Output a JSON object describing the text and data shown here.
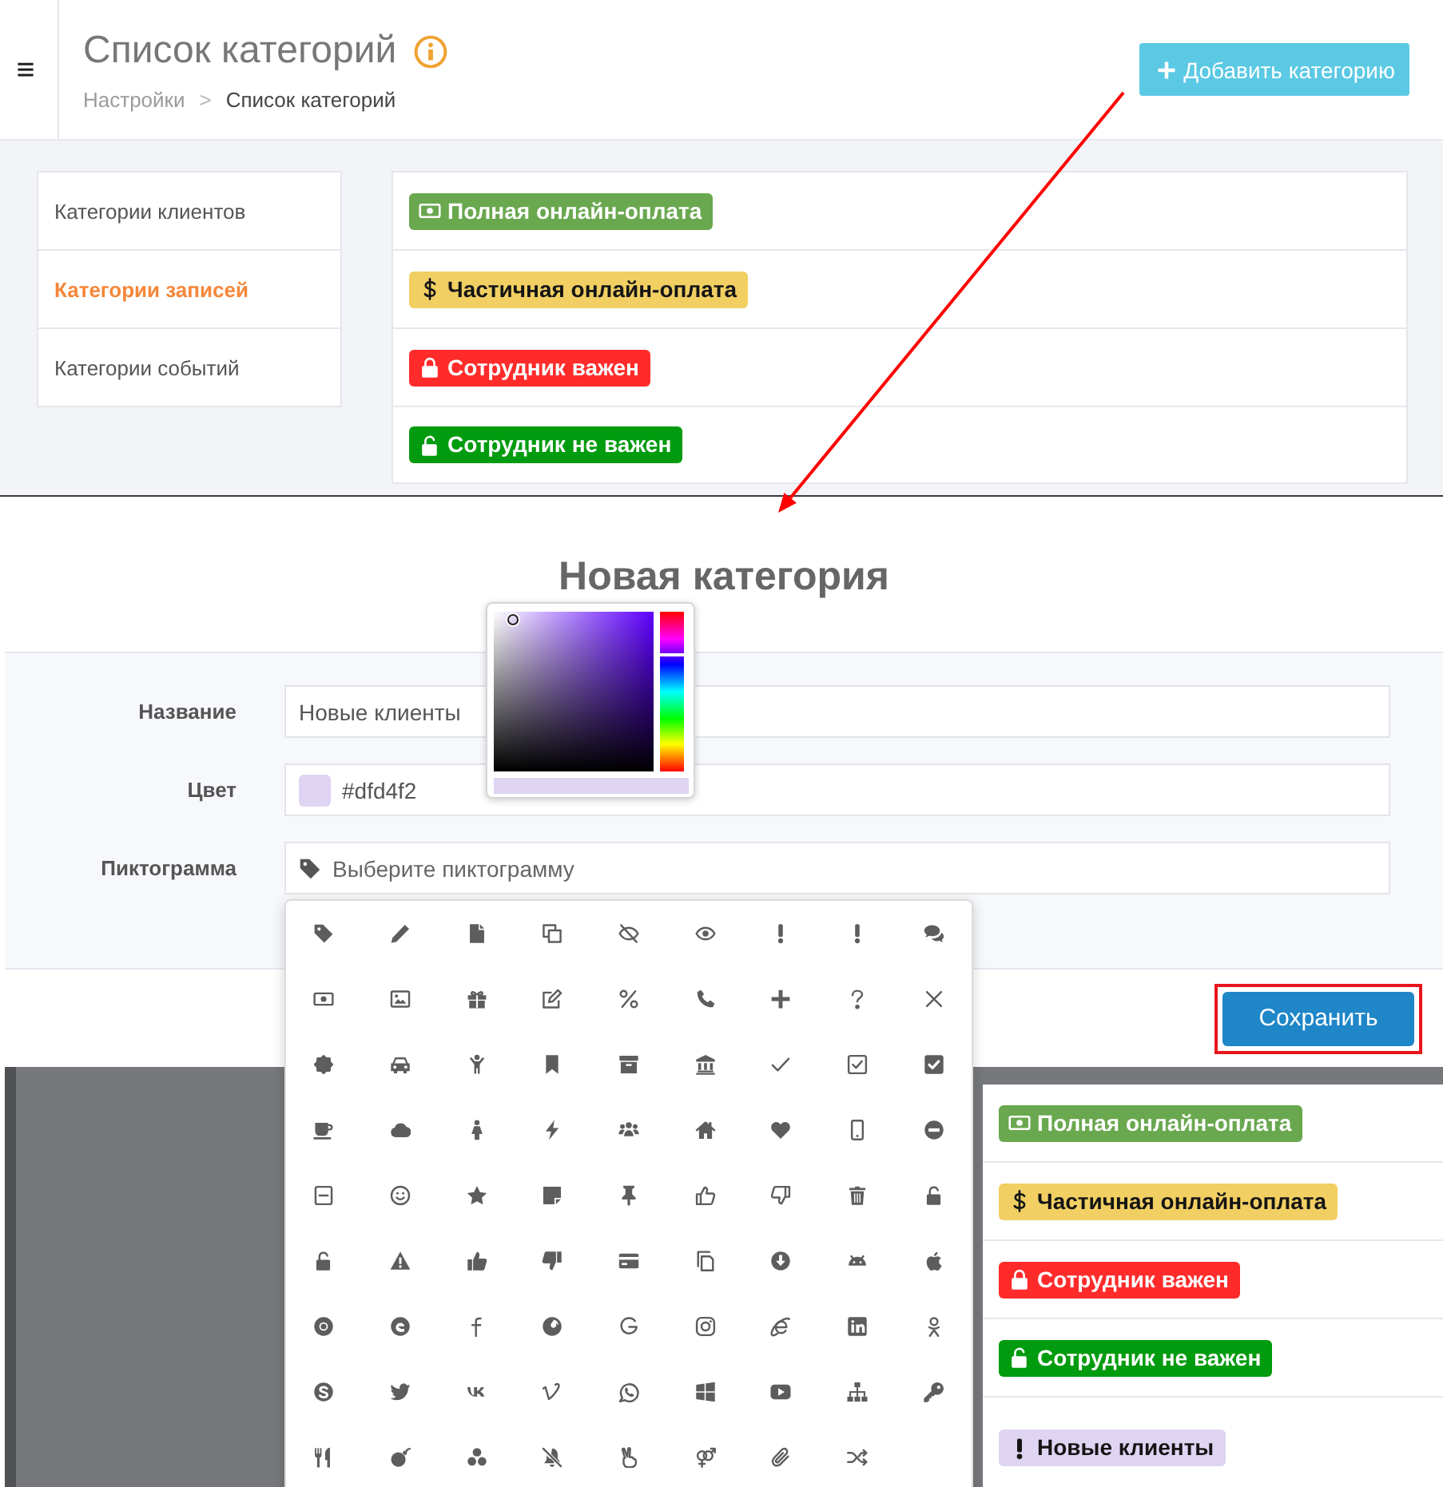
{
  "header": {
    "title": "Список категорий",
    "breadcrumb": [
      {
        "label": "Настройки"
      },
      {
        "label": "Список категорий"
      }
    ],
    "breadcrumb_separator": ">",
    "add_button": "Добавить категорию"
  },
  "category_tabs": [
    {
      "label": "Категории клиентов",
      "selected": false
    },
    {
      "label": "Категории записей",
      "selected": true
    },
    {
      "label": "Категории событий",
      "selected": false
    }
  ],
  "categories": [
    {
      "label": "Полная онлайн-оплата",
      "kind": "money",
      "color": "#6aa84f"
    },
    {
      "label": "Частичная онлайн-оплата",
      "kind": "dollar",
      "color": "#f1cf63"
    },
    {
      "label": "Сотрудник важен",
      "kind": "lock",
      "color": "#ff2b2b"
    },
    {
      "label": "Сотрудник не важен",
      "kind": "unlock",
      "color": "#009b0e"
    }
  ],
  "modal": {
    "title": "Новая категория",
    "fields": [
      {
        "kind": "text",
        "label": "Название",
        "value": "Новые клиенты"
      },
      {
        "kind": "color",
        "label": "Цвет",
        "value": "#dfd4f2",
        "color": "#dfd4f2",
        "picker_open": true
      },
      {
        "kind": "icon",
        "label": "Пиктограмма",
        "placeholder": "Выберите пиктограмму",
        "menu_open": true
      }
    ],
    "save_button": {
      "label": "Сохранить",
      "highlighted": true
    }
  },
  "preview_categories": [
    {
      "label": "Полная онлайн-оплата",
      "kind": "money",
      "color": "#6aa84f"
    },
    {
      "label": "Частичная онлайн-оплата",
      "kind": "dollar",
      "color": "#f1cf63"
    },
    {
      "label": "Сотрудник важен",
      "kind": "lock",
      "color": "#ff2b2b"
    },
    {
      "label": "Сотрудник не важен",
      "kind": "unlock",
      "color": "#009b0e"
    },
    {
      "label": "Новые клиенты",
      "kind": "exclamation",
      "color": "#dfd4f2"
    }
  ]
}
